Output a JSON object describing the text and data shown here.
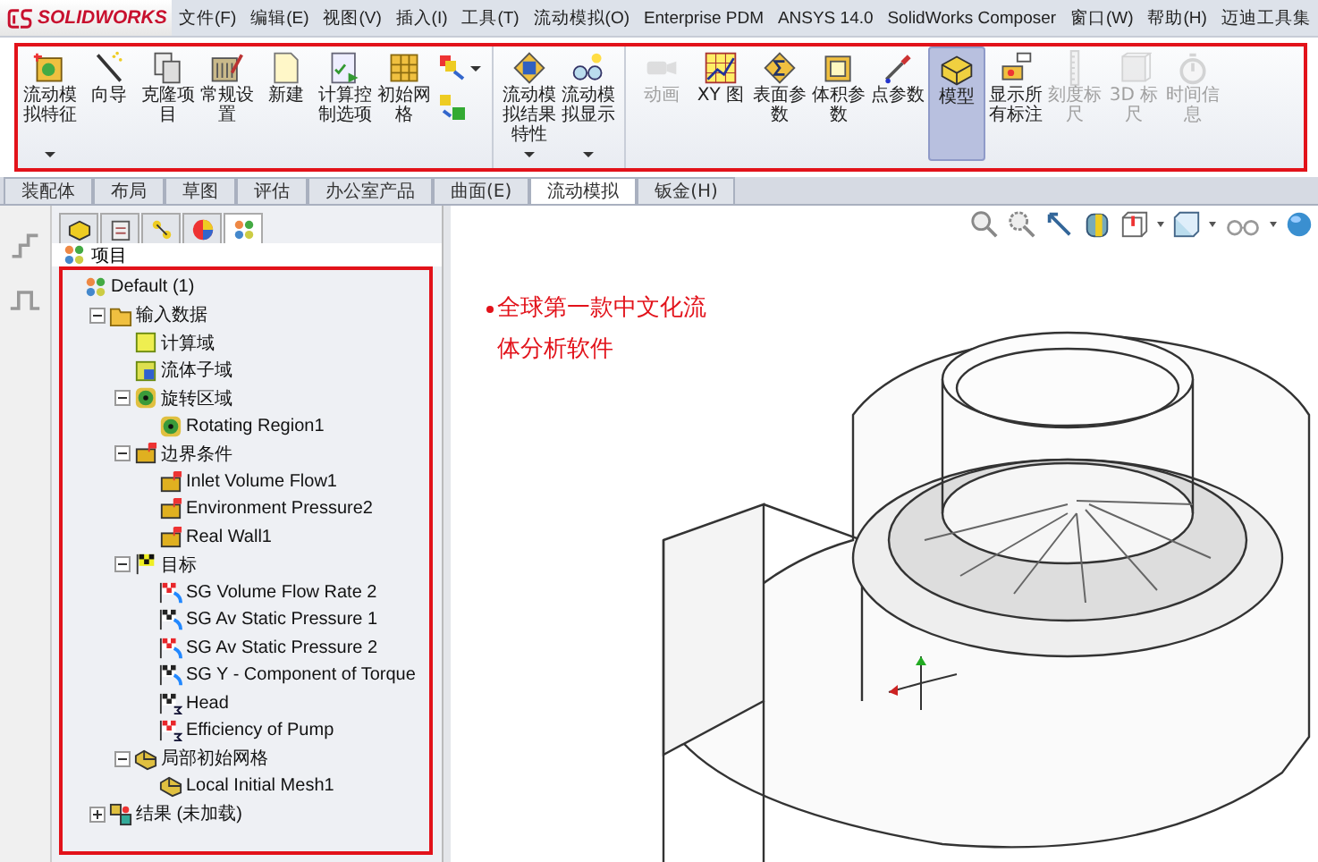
{
  "logo": {
    "text": "SOLIDWORKS"
  },
  "menu": [
    "文件(F)",
    "编辑(E)",
    "视图(V)",
    "插入(I)",
    "工具(T)",
    "流动模拟(O)",
    "Enterprise PDM",
    "ANSYS 14.0",
    "SolidWorks Composer",
    "窗口(W)",
    "帮助(H)",
    "迈迪工具集"
  ],
  "ribbon": [
    {
      "kind": "feature",
      "label": "流动模拟特征",
      "dropdown": true,
      "disabled": false,
      "selected": false
    },
    {
      "kind": "wizard",
      "label": "向导",
      "dropdown": false,
      "disabled": false,
      "selected": false
    },
    {
      "kind": "clone",
      "label": "克隆项目",
      "dropdown": false,
      "disabled": false,
      "selected": false
    },
    {
      "kind": "settings",
      "label": "常规设置",
      "dropdown": false,
      "disabled": false,
      "selected": false
    },
    {
      "kind": "new",
      "label": "新建",
      "dropdown": false,
      "disabled": false,
      "selected": false
    },
    {
      "kind": "control",
      "label": "计算控制选项",
      "dropdown": false,
      "disabled": false,
      "selected": false
    },
    {
      "kind": "mesh",
      "label": "初始网格",
      "dropdown": false,
      "disabled": false,
      "selected": false
    },
    {
      "kind": "stack",
      "dropdown": true
    },
    {
      "kind": "results",
      "label": "流动模拟结果特性",
      "dropdown": true,
      "disabled": false,
      "selected": false
    },
    {
      "kind": "display",
      "label": "流动模拟显示",
      "dropdown": true,
      "disabled": false,
      "selected": false
    },
    {
      "kind": "animation",
      "label": "动画",
      "dropdown": false,
      "disabled": true,
      "selected": false
    },
    {
      "kind": "xy",
      "label": "XY 图",
      "dropdown": false,
      "disabled": false,
      "selected": false
    },
    {
      "kind": "surface",
      "label": "表面参数",
      "dropdown": false,
      "disabled": false,
      "selected": false
    },
    {
      "kind": "volume",
      "label": "体积参数",
      "dropdown": false,
      "disabled": false,
      "selected": false
    },
    {
      "kind": "point",
      "label": "点参数",
      "dropdown": false,
      "disabled": false,
      "selected": false
    },
    {
      "kind": "model",
      "label": "模型",
      "dropdown": false,
      "disabled": false,
      "selected": true
    },
    {
      "kind": "labels",
      "label": "显示所有标注",
      "dropdown": false,
      "disabled": false,
      "selected": false
    },
    {
      "kind": "scale",
      "label": "刻度标尺",
      "dropdown": false,
      "disabled": true,
      "selected": false
    },
    {
      "kind": "ruler3d",
      "label": "3D 标尺",
      "dropdown": false,
      "disabled": true,
      "selected": false
    },
    {
      "kind": "time",
      "label": "时间信息",
      "dropdown": false,
      "disabled": true,
      "selected": false
    }
  ],
  "tabs": [
    {
      "label": "装配体",
      "selected": false
    },
    {
      "label": "布局",
      "selected": false
    },
    {
      "label": "草图",
      "selected": false
    },
    {
      "label": "评估",
      "selected": false
    },
    {
      "label": "办公室产品",
      "selected": false
    },
    {
      "label": "曲面(E)",
      "selected": false
    },
    {
      "label": "流动模拟",
      "selected": true
    },
    {
      "label": "钣金(H)",
      "selected": false
    }
  ],
  "panel": {
    "tabs": [
      {
        "kind": "part",
        "selected": false
      },
      {
        "kind": "properties",
        "selected": false
      },
      {
        "kind": "config",
        "selected": false
      },
      {
        "kind": "appearance",
        "selected": false
      },
      {
        "kind": "flow",
        "selected": true
      }
    ],
    "header": "项目"
  },
  "tree": {
    "label": "Default (1)",
    "kind": "project",
    "children": [
      {
        "label": "输入数据",
        "kind": "input",
        "expanded": true,
        "children": [
          {
            "label": "计算域",
            "kind": "domain"
          },
          {
            "label": "流体子域",
            "kind": "subdomain"
          },
          {
            "label": "旋转区域",
            "kind": "rotating",
            "expanded": true,
            "children": [
              {
                "label": "Rotating Region1",
                "kind": "rotating"
              }
            ]
          },
          {
            "label": "边界条件",
            "kind": "boundary",
            "expanded": true,
            "children": [
              {
                "label": "Inlet Volume Flow1",
                "kind": "boundary"
              },
              {
                "label": "Environment Pressure2",
                "kind": "boundary"
              },
              {
                "label": "Real Wall1",
                "kind": "boundary"
              }
            ]
          },
          {
            "label": "目标",
            "kind": "goals",
            "expanded": true,
            "children": [
              {
                "label": "SG Volume Flow Rate 2",
                "kind": "goal",
                "color": "#e8262a"
              },
              {
                "label": "SG Av Static Pressure 1",
                "kind": "goal",
                "color": "#222222"
              },
              {
                "label": "SG Av Static Pressure 2",
                "kind": "goal",
                "color": "#e8262a"
              },
              {
                "label": "SG Y - Component of Torque",
                "kind": "goal",
                "color": "#222222"
              },
              {
                "label": "Head",
                "kind": "equation_goal",
                "color": "#222222"
              },
              {
                "label": "Efficiency of Pump",
                "kind": "equation_goal",
                "color": "#e8262a"
              }
            ]
          },
          {
            "label": "局部初始网格",
            "kind": "mesh",
            "expanded": true,
            "children": [
              {
                "label": "Local Initial Mesh1",
                "kind": "mesh"
              }
            ]
          }
        ]
      },
      {
        "label": "结果 (未加载)",
        "kind": "results",
        "expanded": false
      }
    ]
  },
  "annotation": "全球第一款中文化流体分析软件"
}
